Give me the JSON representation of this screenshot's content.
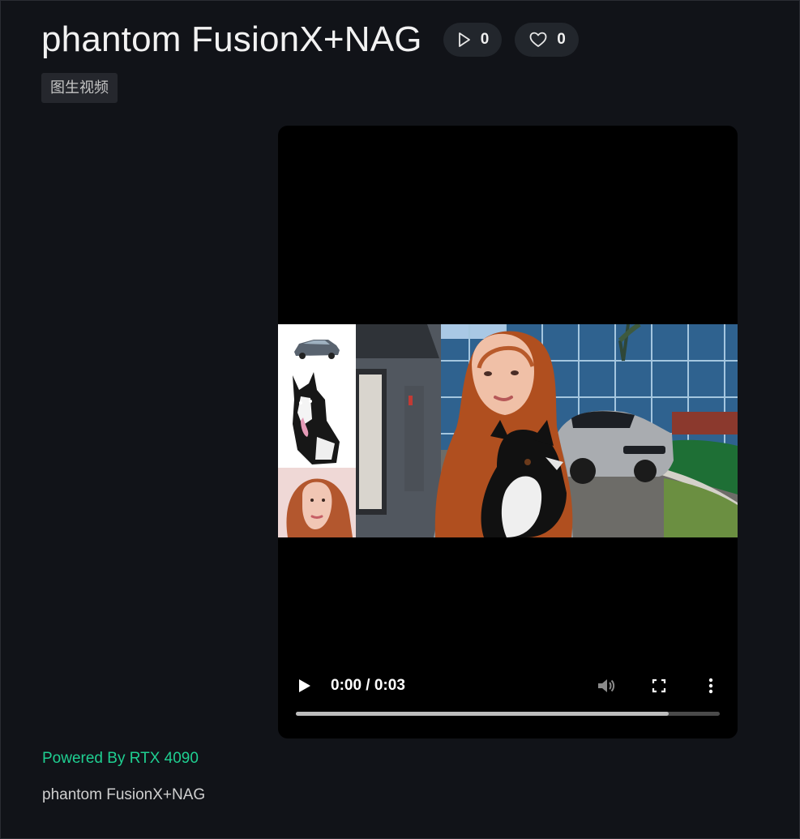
{
  "header": {
    "title": "phantom FusionX+NAG",
    "plays": "0",
    "likes": "0"
  },
  "tag": "图生视频",
  "player": {
    "time": "0:00 / 0:03",
    "progress": 0.88
  },
  "footer": {
    "powered": "Powered By RTX 4090",
    "name": "phantom FusionX+NAG"
  },
  "colors": {
    "background": "#111318",
    "accent": "#1fcf91",
    "pill": "#22262c"
  }
}
